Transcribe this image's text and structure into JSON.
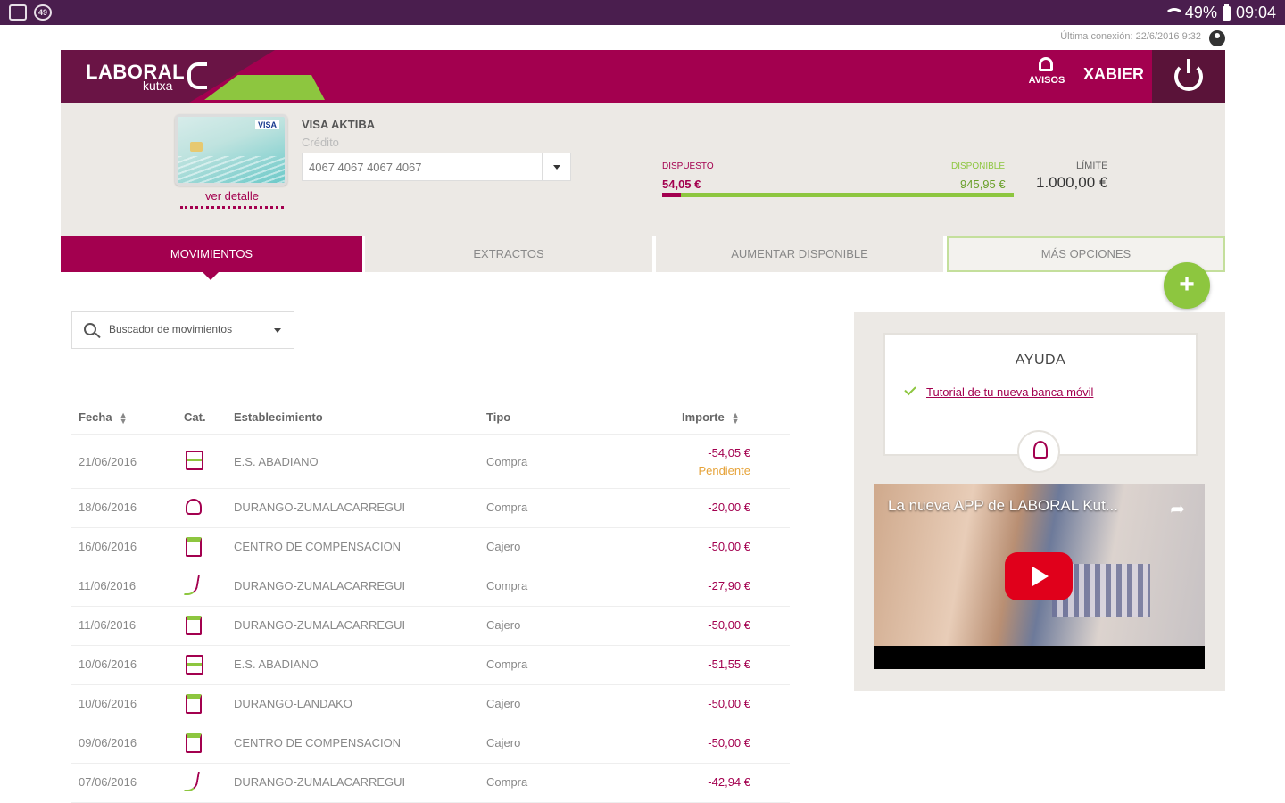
{
  "status_bar": {
    "battery": "49%",
    "time": "09:04"
  },
  "last_connection": "Última conexión: 22/6/2016 9:32",
  "header": {
    "logo_main": "LABORAL",
    "logo_sub": "kutxa",
    "alerts_label": "AVISOS",
    "user": "XABIER"
  },
  "card": {
    "name": "VISA AKTIBA",
    "type": "Crédito",
    "number": "4067 4067 4067 4067",
    "detail_link": "ver detalle",
    "disposed_label": "DISPUESTO",
    "disposed_value": "54,05 €",
    "available_label": "DISPONIBLE",
    "available_value": "945,95 €",
    "limit_label": "LÍMITE",
    "limit_value": "1.000,00 €",
    "used_fraction": 0.054
  },
  "tabs": [
    "MOVIMIENTOS",
    "EXTRACTOS",
    "AUMENTAR DISPONIBLE",
    "MÁS OPCIONES"
  ],
  "search": {
    "label": "Buscador de movimientos"
  },
  "table": {
    "headers": {
      "date": "Fecha",
      "cat": "Cat.",
      "place": "Establecimiento",
      "type": "Tipo",
      "amount": "Importe"
    },
    "rows": [
      {
        "date": "21/06/2016",
        "place": "E.S. ABADIANO",
        "type": "Compra",
        "amount": "-54,05 €",
        "status": "Pendiente"
      },
      {
        "date": "18/06/2016",
        "place": "DURANGO-ZUMALACARREGUI",
        "type": "Compra",
        "amount": "-20,00 €"
      },
      {
        "date": "16/06/2016",
        "place": "CENTRO DE COMPENSACION",
        "type": "Cajero",
        "amount": "-50,00 €"
      },
      {
        "date": "11/06/2016",
        "place": "DURANGO-ZUMALACARREGUI",
        "type": "Compra",
        "amount": "-27,90 €"
      },
      {
        "date": "11/06/2016",
        "place": "DURANGO-ZUMALACARREGUI",
        "type": "Cajero",
        "amount": "-50,00 €"
      },
      {
        "date": "10/06/2016",
        "place": "E.S. ABADIANO",
        "type": "Compra",
        "amount": "-51,55 €"
      },
      {
        "date": "10/06/2016",
        "place": "DURANGO-LANDAKO",
        "type": "Cajero",
        "amount": "-50,00 €"
      },
      {
        "date": "09/06/2016",
        "place": "CENTRO DE COMPENSACION",
        "type": "Cajero",
        "amount": "-50,00 €"
      },
      {
        "date": "07/06/2016",
        "place": "DURANGO-ZUMALACARREGUI",
        "type": "Compra",
        "amount": "-42,94 €"
      }
    ]
  },
  "help": {
    "title": "AYUDA",
    "link": "Tutorial de tu nueva banca móvil",
    "video_title": "La nueva APP de LABORAL Kut..."
  },
  "colors": {
    "brand": "#a3004f",
    "accent": "#8dc63f",
    "status_bar": "#4a1e4e"
  }
}
